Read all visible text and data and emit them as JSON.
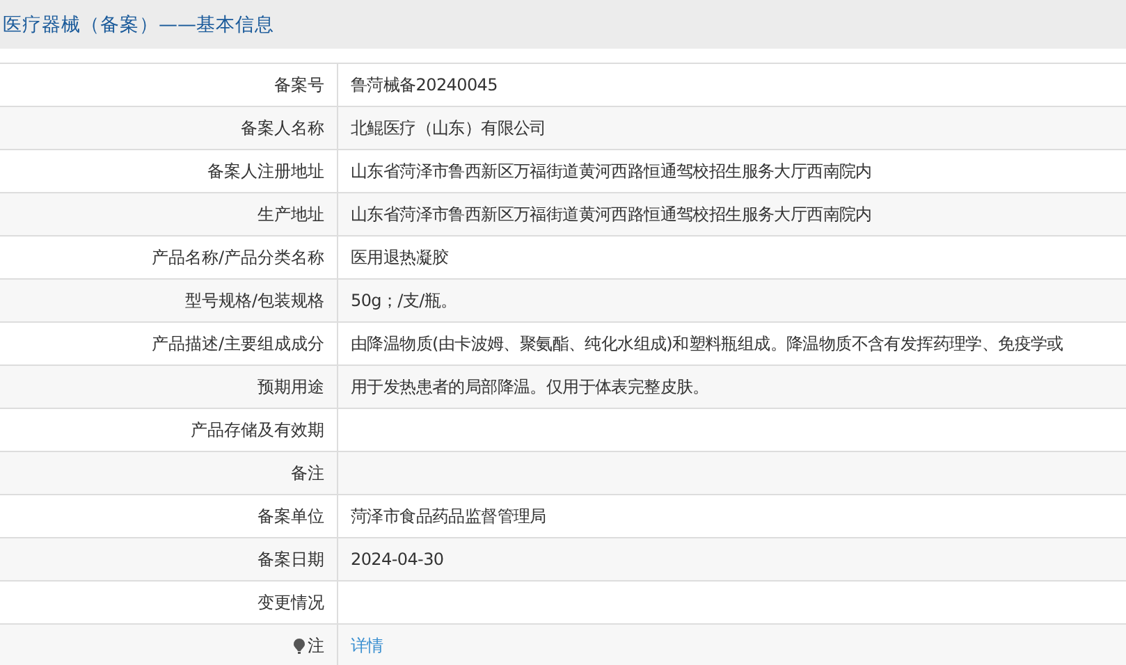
{
  "title": "医疗器械（备案）——基本信息",
  "rows": [
    {
      "label": "备案号",
      "value": "鲁菏械备20240045"
    },
    {
      "label": "备案人名称",
      "value": "北鲲医疗（山东）有限公司"
    },
    {
      "label": "备案人注册地址",
      "value": "山东省菏泽市鲁西新区万福街道黄河西路恒通驾校招生服务大厅西南院内"
    },
    {
      "label": "生产地址",
      "value": "山东省菏泽市鲁西新区万福街道黄河西路恒通驾校招生服务大厅西南院内"
    },
    {
      "label": "产品名称/产品分类名称",
      "value": "医用退热凝胶"
    },
    {
      "label": "型号规格/包装规格",
      "value": "50g；/支/瓶。"
    },
    {
      "label": "产品描述/主要组成成分",
      "value": "由降温物质(由卡波姆、聚氨酯、纯化水组成)和塑料瓶组成。降温物质不含有发挥药理学、免疫学或"
    },
    {
      "label": "预期用途",
      "value": "用于发热患者的局部降温。仅用于体表完整皮肤。"
    },
    {
      "label": "产品存储及有效期"
    },
    {
      "label": "备注"
    },
    {
      "label": "备案单位",
      "value": "菏泽市食品药品监督管理局"
    },
    {
      "label": "备案日期",
      "value": "2024-04-30"
    },
    {
      "label": "变更情况"
    },
    {
      "label": "注",
      "kind": "note",
      "link": "详情"
    }
  ]
}
